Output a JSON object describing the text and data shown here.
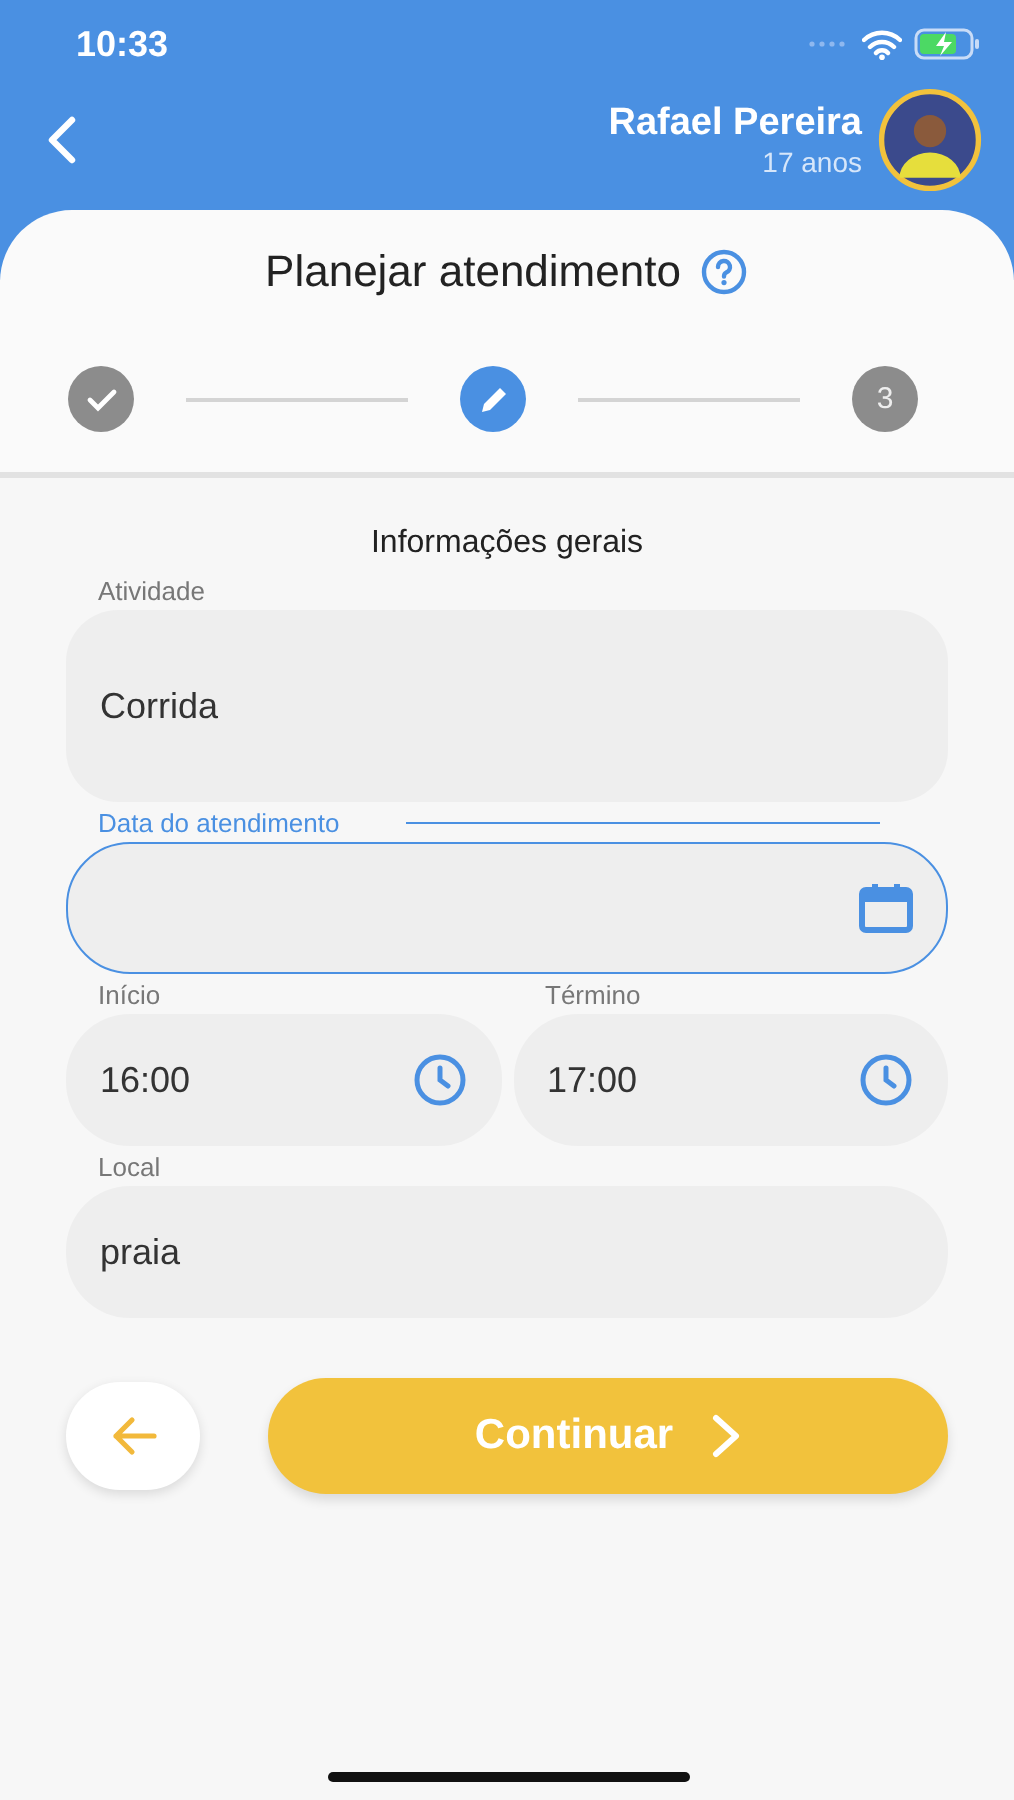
{
  "status_bar": {
    "time": "10:33"
  },
  "header": {
    "name": "Rafael Pereira",
    "age": "17 anos"
  },
  "title": "Planejar atendimento",
  "steps": [
    {
      "done": true,
      "selected": false
    },
    {
      "done": false,
      "selected": true
    },
    {
      "done": false,
      "selected": false,
      "label": "3"
    }
  ],
  "section_title": "Informações gerais",
  "fields": [
    {
      "kind": "text",
      "label": "Atividade",
      "value": "Corrida",
      "focused": false,
      "tall": true
    },
    {
      "kind": "date",
      "label": "Data do atendimento",
      "focused": true,
      "tall": false
    },
    {
      "kind": "time",
      "label": "Início",
      "value": "16:00",
      "focused": false,
      "tall": false
    },
    {
      "kind": "time",
      "label": "Término",
      "value": "17:00",
      "focused": false,
      "tall": false
    },
    {
      "kind": "text",
      "label": "Local",
      "value": "praia",
      "focused": false,
      "tall": false
    }
  ],
  "continue_button": "Continuar"
}
